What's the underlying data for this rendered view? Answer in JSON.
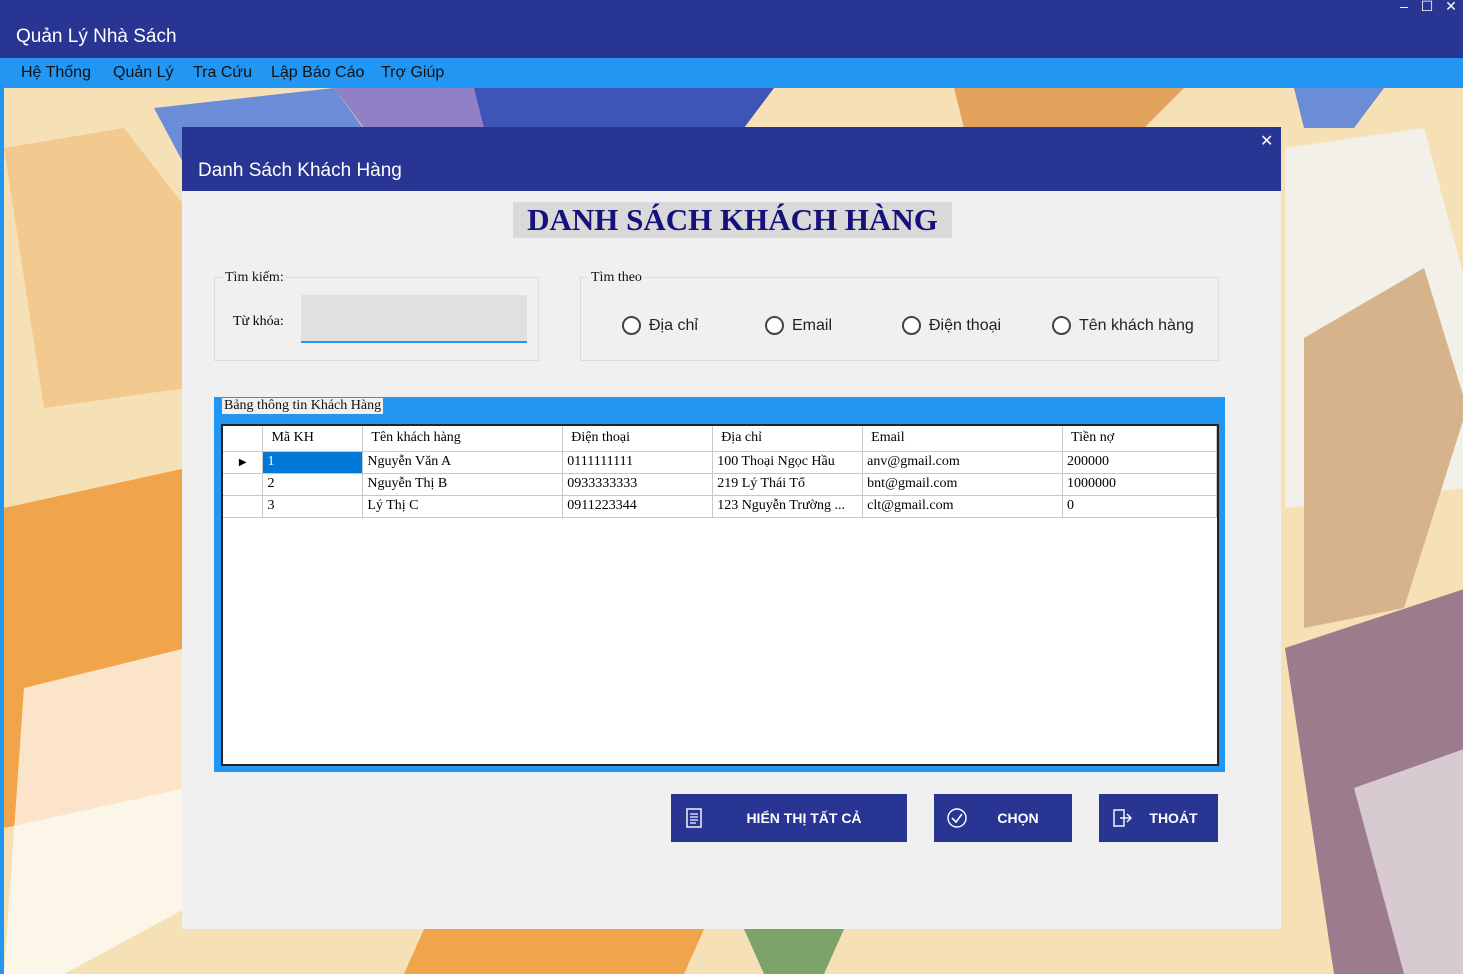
{
  "window": {
    "title": "Quản Lý Nhà Sách",
    "controls": {
      "minimize": "–",
      "maximize": "☐",
      "close": "✕"
    }
  },
  "menu": [
    {
      "label": "Hệ Thống"
    },
    {
      "label": "Quản Lý"
    },
    {
      "label": "Tra Cứu"
    },
    {
      "label": "Lập Báo Cáo"
    },
    {
      "label": "Trợ Giúp"
    }
  ],
  "dialog": {
    "title": "Danh Sách Khách Hàng",
    "close": "✕",
    "heading": "DANH SÁCH KHÁCH HÀNG",
    "search": {
      "group_label": "Tìm kiếm:",
      "keyword_label": "Từ khóa:",
      "keyword_value": ""
    },
    "filter": {
      "group_label": "Tìm theo",
      "options": [
        "Địa chỉ",
        "Email",
        "Điện thoại",
        "Tên khách hàng"
      ]
    },
    "table": {
      "group_label": "Bảng thông tin Khách Hàng",
      "columns": [
        "Mã KH",
        "Tên khách hàng",
        "Điện thoại",
        "Địa chỉ",
        "Email",
        "Tiền nợ"
      ],
      "rows": [
        [
          "1",
          "Nguyễn Văn A",
          "0111111111",
          "100 Thoại Ngọc Hầu",
          "anv@gmail.com",
          "200000"
        ],
        [
          "2",
          "Nguyễn Thị B",
          "0933333333",
          "219 Lý Thái Tổ",
          "bnt@gmail.com",
          "1000000"
        ],
        [
          "3",
          "Lý Thị C",
          "0911223344",
          "123 Nguyễn Trường ...",
          "clt@gmail.com",
          "0"
        ]
      ],
      "current_row_marker": "▶"
    },
    "buttons": {
      "show_all": "HIỂN THỊ TẤT CẢ",
      "choose": "CHỌN",
      "exit": "THOÁT"
    }
  },
  "colors": {
    "title_bar": "#283593",
    "menu_bar": "#2196f3",
    "accent": "#0078d7"
  }
}
